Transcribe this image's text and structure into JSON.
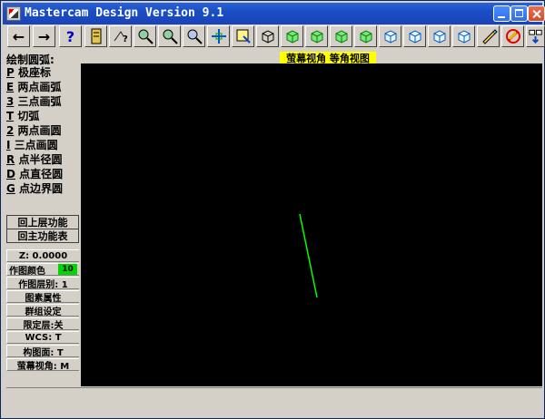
{
  "window": {
    "title": "Mastercam Design Version 9.1",
    "accent": "#1b43b8",
    "viewport_background": "#000000",
    "view_label_background": "#ffff00"
  },
  "toolbar": {
    "buttons": [
      {
        "label": "←"
      },
      {
        "label": "→"
      },
      {
        "label": "?"
      },
      {
        "label": ""
      },
      {
        "label": ""
      },
      {
        "label": ""
      },
      {
        "label": ""
      },
      {
        "label": ""
      },
      {
        "label": ""
      },
      {
        "label": ""
      },
      {
        "label": ""
      },
      {
        "label": ""
      },
      {
        "label": ""
      },
      {
        "label": ""
      },
      {
        "label": ""
      },
      {
        "label": ""
      },
      {
        "label": ""
      },
      {
        "label": ""
      },
      {
        "label": ""
      },
      {
        "label": ""
      },
      {
        "label": ""
      },
      {
        "label": ""
      }
    ]
  },
  "header": {
    "mode_title": "绘制圆弧:",
    "view_label": "萤幕视角 等角视图"
  },
  "sidebar": {
    "items": [
      {
        "hotkey": "P",
        "label": "极座标"
      },
      {
        "hotkey": "E",
        "label": "两点画弧"
      },
      {
        "hotkey": "3",
        "label": "三点画弧"
      },
      {
        "hotkey": "T",
        "label": "切弧"
      },
      {
        "hotkey": "2",
        "label": "两点画圆"
      },
      {
        "hotkey": "I",
        "label": "三点画圆"
      },
      {
        "hotkey": "R",
        "label": "点半径圆"
      },
      {
        "hotkey": "D",
        "label": "点直径圆"
      },
      {
        "hotkey": "G",
        "label": "点边界圆"
      }
    ],
    "back_button": "回上层功能",
    "main_button": "回主功能表",
    "settings": {
      "z": "Z:  0.0000",
      "color": "作图颜色",
      "color_value": "10",
      "level": "作图层别:  1",
      "attributes": "图素属性",
      "group": "群组设定",
      "limit": "限定层:关",
      "wcs": "WCS:  T",
      "cplane": "构图面:  T",
      "gview": "萤幕视角: M"
    }
  }
}
